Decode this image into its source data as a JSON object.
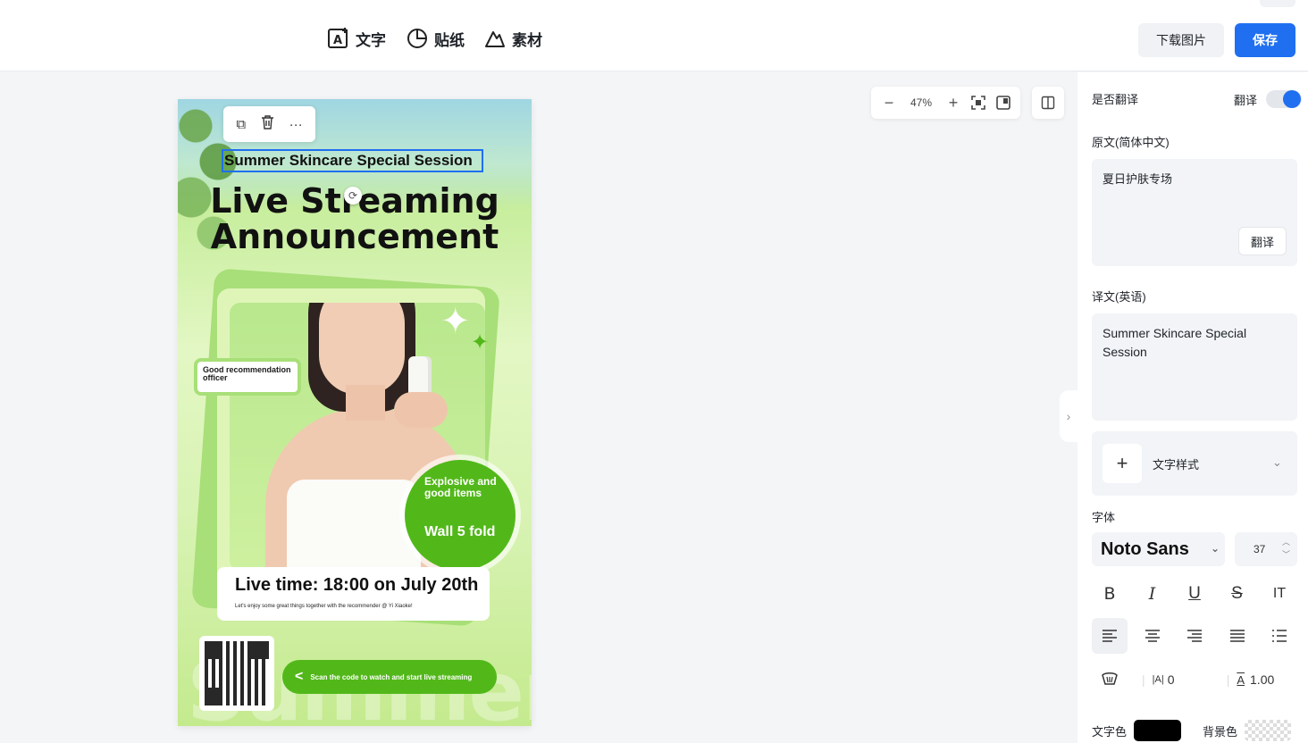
{
  "toolbar": {
    "tools": [
      {
        "label": "文字",
        "icon": "add-text-icon"
      },
      {
        "label": "贴纸",
        "icon": "sticker-icon"
      },
      {
        "label": "素材",
        "icon": "material-icon"
      }
    ],
    "download_label": "下载图片",
    "save_label": "保存"
  },
  "zoom": {
    "value": "47%"
  },
  "poster": {
    "selected_text": "Summer Skincare Special Session",
    "title_line1": "Live Streaming",
    "title_line2": "Announcement",
    "badge": "Good recommendation officer",
    "circle_line1": "Explosive and good items",
    "circle_line2": "Wall 5 fold",
    "live_time": "Live time: 18:00 on July 20th",
    "subtitle": "Let's enjoy some great things together with the recommender @ Yi Xiaoke!",
    "scan_text": "Scan the code to watch and start live streaming",
    "watermark": "Summer"
  },
  "panel": {
    "translate_toggle_label": "是否翻译",
    "translate_switch_label": "翻译",
    "translate_on": true,
    "source_label": "原文(简体中文)",
    "source_text": "夏日护肤专场",
    "translate_button": "翻译",
    "target_label": "译文(英语)",
    "target_text": "Summer Skincare Special Session",
    "text_style_label": "文字样式",
    "font_label": "字体",
    "font_name": "Noto Sans",
    "font_size": "37",
    "letter_spacing": "0",
    "line_height": "1.00",
    "text_color_label": "文字色",
    "bg_color_label": "背景色"
  },
  "colors": {
    "accent": "#1f6ff0",
    "poster_green": "#52b81a"
  }
}
